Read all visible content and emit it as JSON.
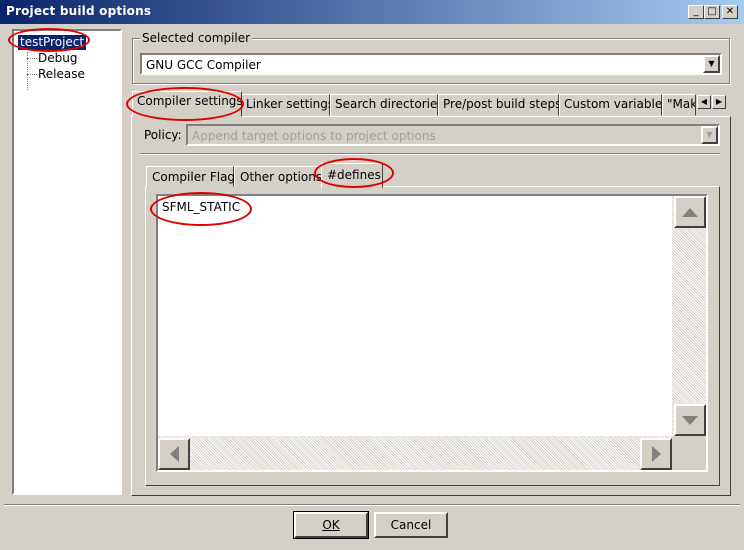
{
  "window": {
    "title": "Project build options",
    "minimize_icon": "minimize-icon",
    "maximize_icon": "maximize-icon",
    "close_icon": "close-icon"
  },
  "tree": {
    "root": "testProject",
    "children": [
      "Debug",
      "Release"
    ]
  },
  "compiler": {
    "group_label": "Selected compiler",
    "selected": "GNU GCC Compiler"
  },
  "tabs": [
    "Compiler settings",
    "Linker settings",
    "Search directories",
    "Pre/post build steps",
    "Custom variables",
    "\"Make"
  ],
  "active_tab": "Compiler settings",
  "policy": {
    "label": "Policy:",
    "value": "Append target options to project options"
  },
  "subtabs": [
    "Compiler Flags",
    "Other options",
    "#defines"
  ],
  "active_subtab": "#defines",
  "defines_text": "SFML_STATIC",
  "buttons": {
    "ok": "OK",
    "cancel": "Cancel"
  },
  "colors": {
    "titlebar_start": "#0a246a",
    "titlebar_end": "#a6caf0",
    "annotation_ring": "#e00000",
    "face": "#d4d0c8"
  }
}
